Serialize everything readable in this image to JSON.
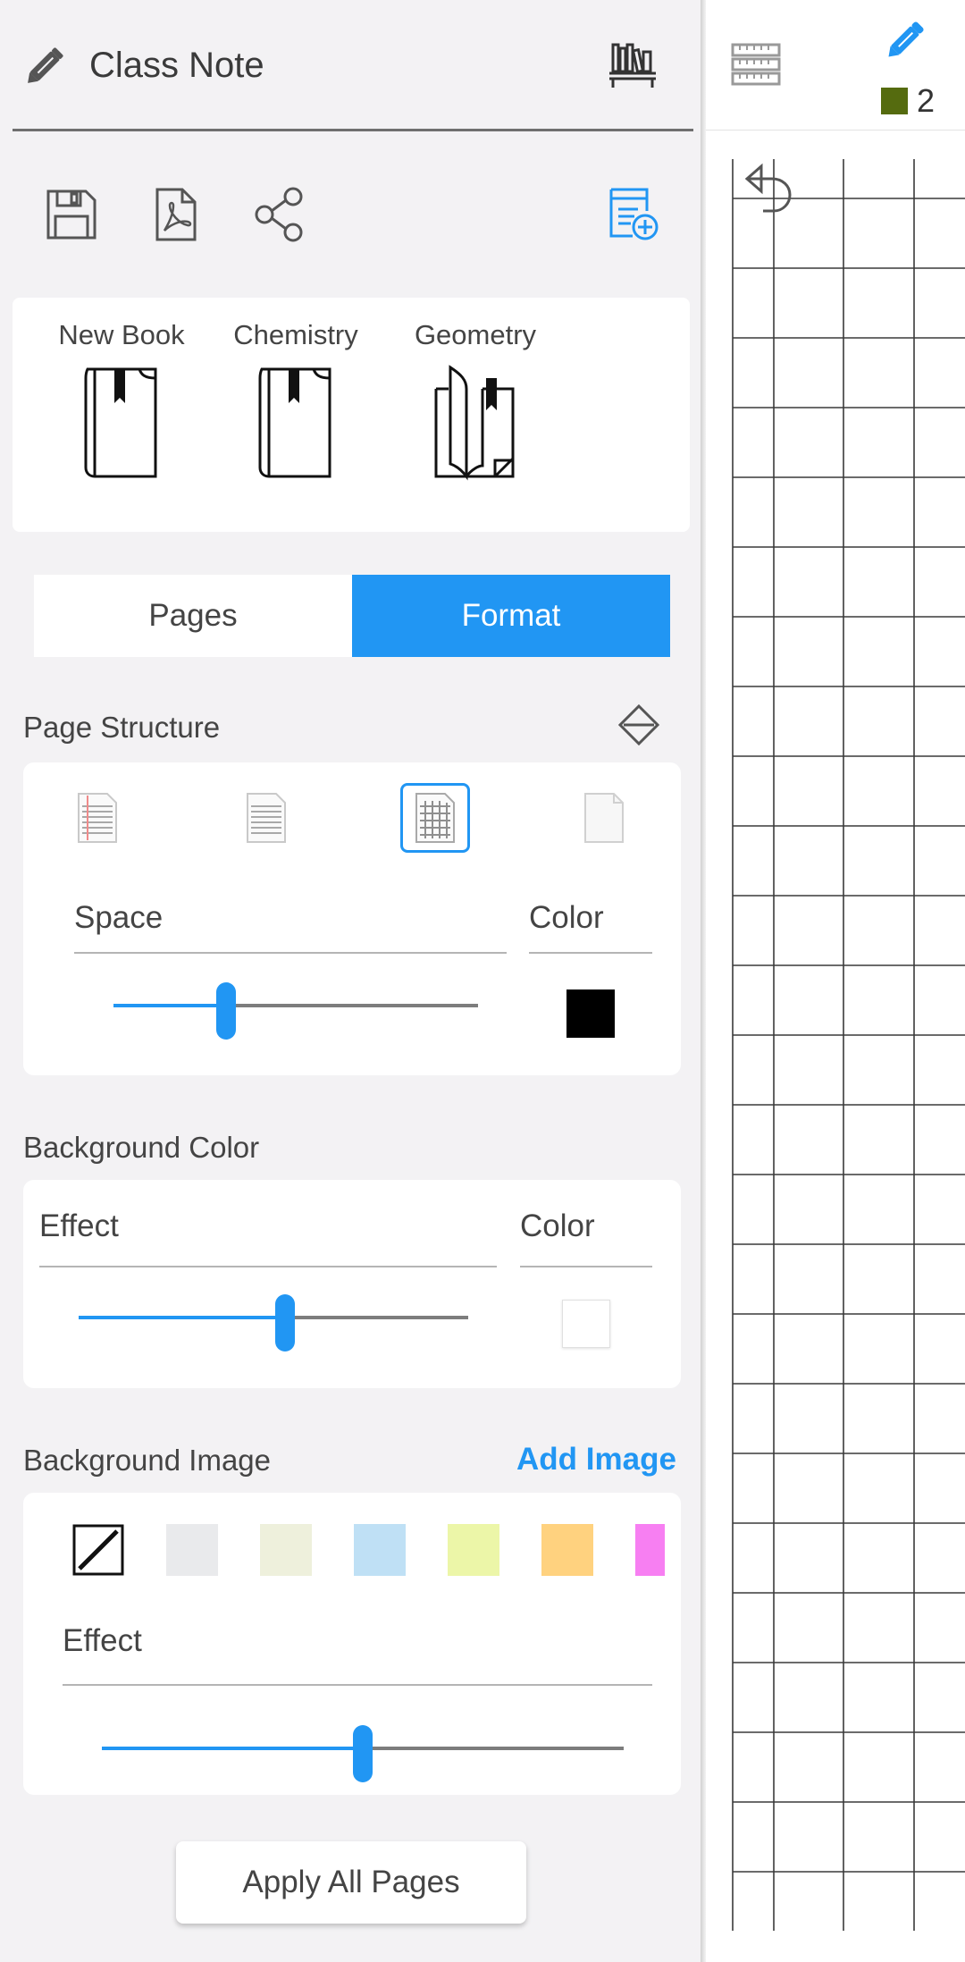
{
  "app": {
    "title": "Class Note"
  },
  "icons": {
    "app": "pencil-icon",
    "library": "bookshelf-icon",
    "save": "save-icon",
    "pdf": "pdf-icon",
    "share": "share-icon",
    "new_book": "add-book-icon",
    "structure_toggle": "collapse-toggle-icon",
    "menu": "ruler-menu-icon",
    "pen": "pen-icon",
    "undo": "undo-icon"
  },
  "books": [
    {
      "label": "New Book"
    },
    {
      "label": "Chemistry"
    },
    {
      "label": "Geometry"
    }
  ],
  "tabs": {
    "pages": "Pages",
    "format": "Format",
    "active": "Format"
  },
  "page_structure": {
    "title": "Page Structure",
    "options": [
      "lined-red-margin",
      "lined",
      "grid",
      "blank"
    ],
    "selected": "grid",
    "space_label": "Space",
    "color_label": "Color",
    "space_value": 0.31,
    "color": "#000000"
  },
  "background_color": {
    "title": "Background Color",
    "effect_label": "Effect",
    "color_label": "Color",
    "effect_value": 0.53,
    "color": "#ffffff"
  },
  "background_image": {
    "title": "Background Image",
    "add_label": "Add Image",
    "swatches": [
      "none",
      "#e9eaec",
      "#eef0dc",
      "#bfe0f5",
      "#ecf6a8",
      "#ffd27f",
      "#f77ff2"
    ],
    "effect_label": "Effect",
    "effect_value": 0.5
  },
  "apply_label": "Apply All Pages",
  "pen": {
    "color": "#556b0f",
    "size": "2"
  },
  "colors": {
    "accent": "#2196f3",
    "drawer_bg": "#f3f2f4",
    "grid_line": "#3a3a3a"
  }
}
